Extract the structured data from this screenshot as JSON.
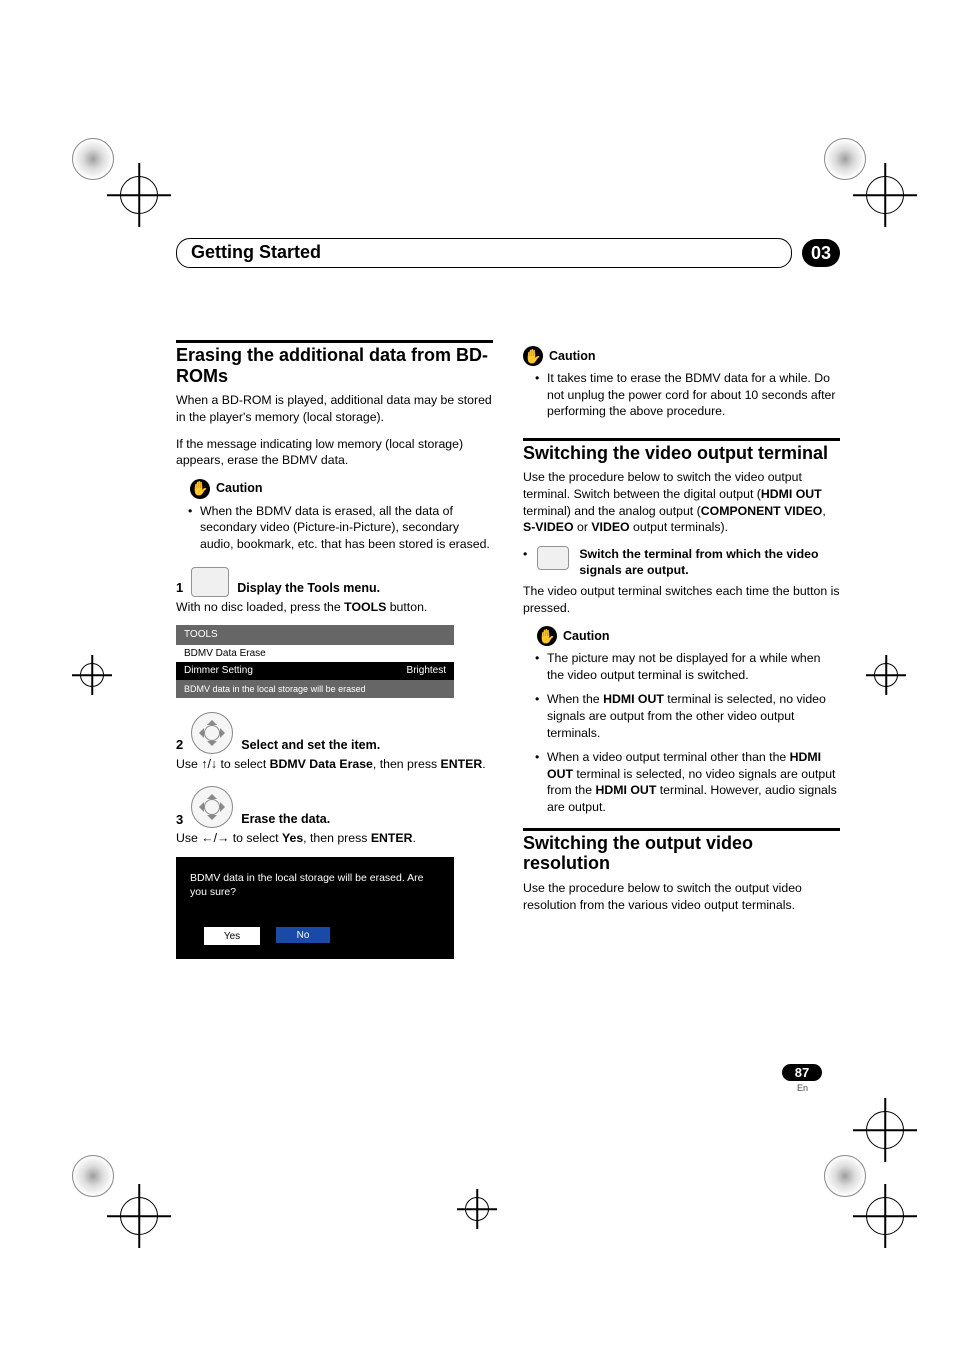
{
  "header": {
    "title": "Getting Started",
    "chapter": "03"
  },
  "left": {
    "h1": "Erasing the additional data from BD-ROMs",
    "p1": "When a BD-ROM is played, additional data may be stored in the player's memory (local storage).",
    "p2": "If the message indicating low memory (local storage) appears, erase the BDMV data.",
    "caution1_label": "Caution",
    "caution1_item": "When the BDMV data is erased, all the data of secondary video (Picture-in-Picture), secondary audio, bookmark, etc. that has been stored is erased.",
    "step1_num": "1",
    "step1_text": "Display the Tools menu.",
    "step1_body_a": "With no disc loaded, press the ",
    "step1_body_b": "TOOLS",
    "step1_body_c": " button.",
    "tools_menu": {
      "title": "TOOLS",
      "items": [
        {
          "label": "BDMV Data Erase",
          "value": ""
        },
        {
          "label": "Dimmer Setting",
          "value": "Brightest"
        }
      ],
      "footer": "BDMV data in the local storage will be erased"
    },
    "step2_num": "2",
    "step2_text": "Select and set the item.",
    "step2_body_a": "Use ",
    "step2_body_b": " to select ",
    "step2_body_c": "BDMV Data Erase",
    "step2_body_d": ", then press ",
    "step2_body_e": "ENTER",
    "step2_body_f": ".",
    "step3_num": "3",
    "step3_text": "Erase the data.",
    "step3_body_a": "Use ",
    "step3_body_b": " to select ",
    "step3_body_c": "Yes",
    "step3_body_d": ", then press ",
    "step3_body_e": "ENTER",
    "step3_body_f": ".",
    "dialog": {
      "msg": "BDMV data in the local storage will be erased. Are you sure?",
      "yes": "Yes",
      "no": "No"
    }
  },
  "right": {
    "caution_top_label": "Caution",
    "caution_top_item": "It takes time to erase the BDMV data for a while. Do not unplug the power cord for about 10 seconds after performing the above procedure.",
    "h2": "Switching the video output terminal",
    "p3a": "Use the procedure below to switch the video output terminal. Switch between the digital output (",
    "p3b": "HDMI OUT",
    "p3c": " terminal) and the analog output (",
    "p3d": "COMPONENT VIDEO",
    "p3e": ", ",
    "p3f": "S-VIDEO",
    "p3g": " or ",
    "p3h": "VIDEO",
    "p3i": " output terminals).",
    "switch_bullet_a": "Switch the terminal from which the video signals are output.",
    "switch_body": "The video output terminal switches each time the button is pressed.",
    "caution2_label": "Caution",
    "c2_i1": "The picture may not be displayed for a while when the video output terminal is switched.",
    "c2_i2a": "When the ",
    "c2_i2b": "HDMI OUT",
    "c2_i2c": " terminal is selected, no video signals are output from the other video output terminals.",
    "c2_i3a": "When a video output terminal other than the ",
    "c2_i3b": "HDMI OUT",
    "c2_i3c": " terminal is selected, no video signals are output from the ",
    "c2_i3d": "HDMI OUT",
    "c2_i3e": " terminal. However, audio signals are output.",
    "h3": "Switching the output video resolution",
    "p4": "Use the procedure below to switch the output video resolution from the various video output terminals."
  },
  "page": {
    "num": "87",
    "lang": "En"
  },
  "glyphs": {
    "hand": "✋",
    "updown": "/",
    "leftright": "/"
  }
}
